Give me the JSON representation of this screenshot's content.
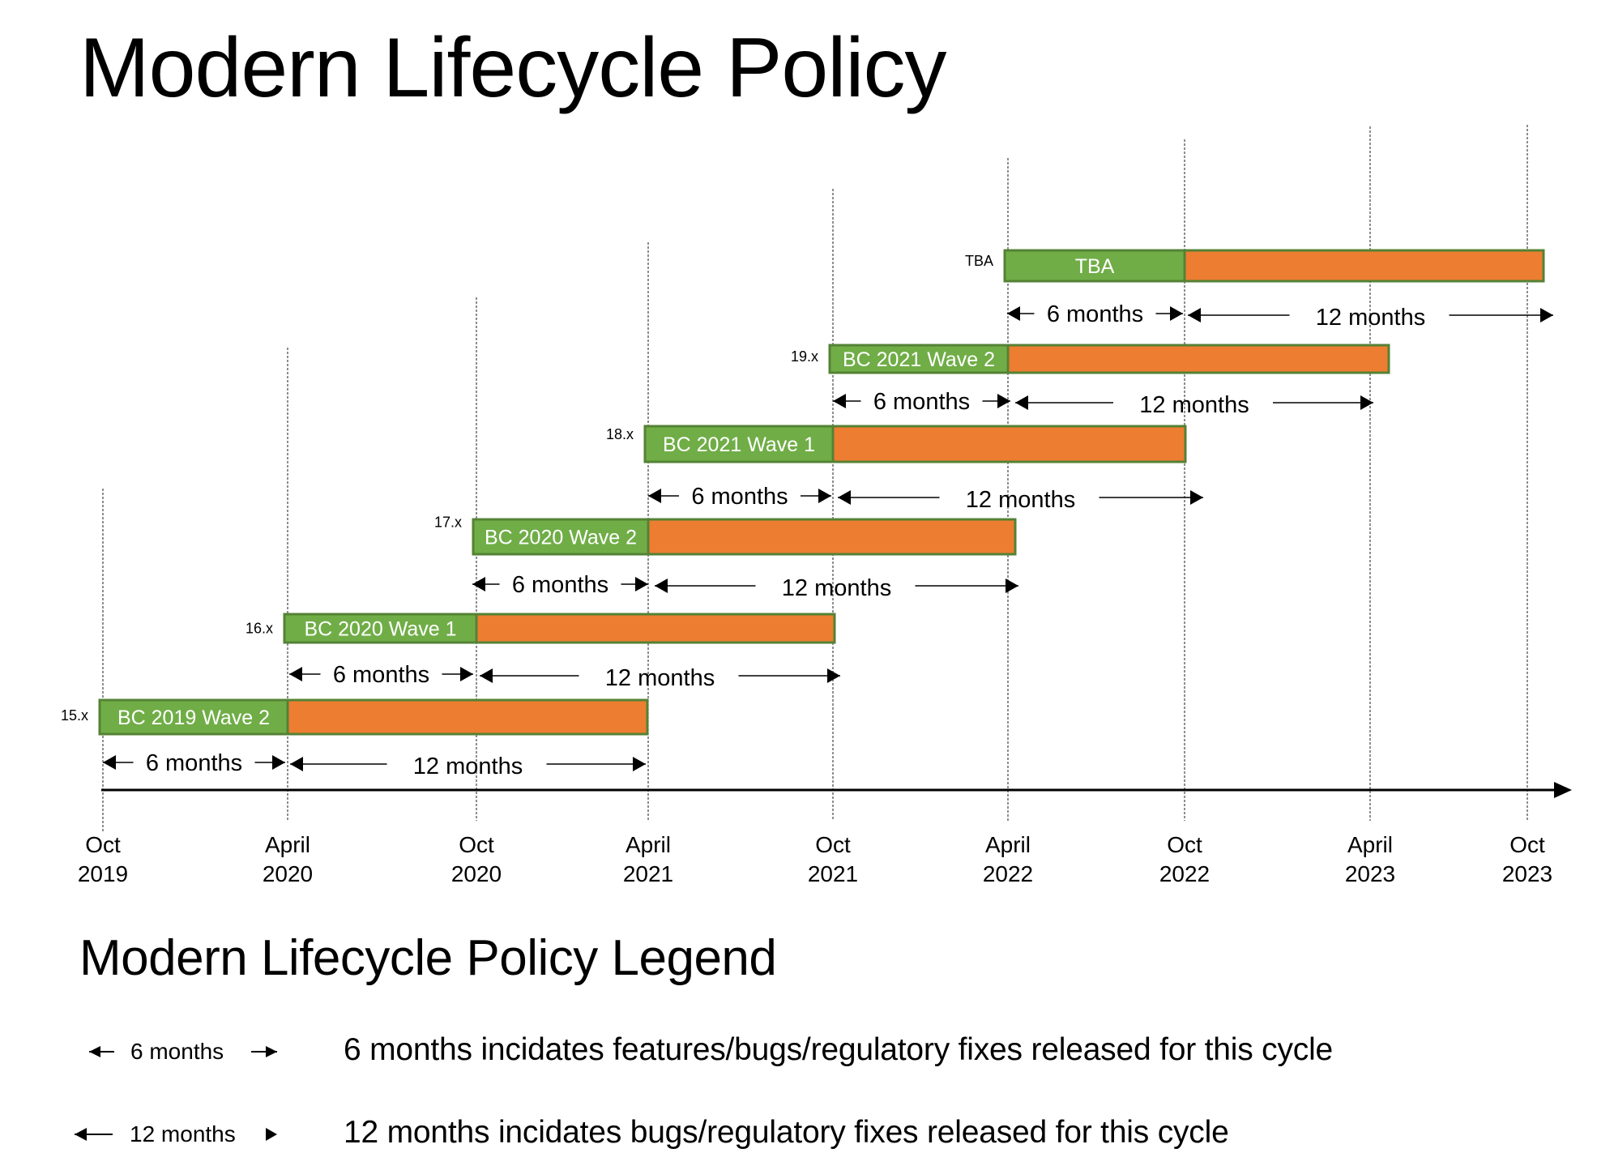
{
  "title": "Modern Lifecycle Policy",
  "colors": {
    "mainstream": "#70AD47",
    "extended": "#ED7D31",
    "bar_border": "#548235",
    "axis": "#000000",
    "gridline": "#444444"
  },
  "chart_data": {
    "type": "gantt",
    "title": "Modern Lifecycle Policy",
    "xlabel": "",
    "ylabel": "",
    "x_unit": "months since Oct 2019",
    "xlim": [
      0,
      48
    ],
    "ticks": [
      {
        "m": 0,
        "month": "Oct",
        "year": "2019"
      },
      {
        "m": 6,
        "month": "April",
        "year": "2020"
      },
      {
        "m": 12,
        "month": "Oct",
        "year": "2020"
      },
      {
        "m": 18,
        "month": "April",
        "year": "2021"
      },
      {
        "m": 24,
        "month": "Oct",
        "year": "2021"
      },
      {
        "m": 30,
        "month": "April",
        "year": "2022"
      },
      {
        "m": 36,
        "month": "Oct",
        "year": "2022"
      },
      {
        "m": 42,
        "month": "April",
        "year": "2023"
      },
      {
        "m": 48,
        "month": "Oct",
        "year": "2023"
      }
    ],
    "series": [
      {
        "name": "6 months",
        "meaning": "mainstream (features/bugs/regulatory fixes)"
      },
      {
        "name": "12 months",
        "meaning": "extended (bugs/regulatory fixes)"
      }
    ],
    "releases": [
      {
        "version": "15.x",
        "name": "BC 2019 Wave 2",
        "start": 0,
        "mainstream_months": 6,
        "extended_months": 12,
        "span_label_1": "6 months",
        "span_label_2": "12 months"
      },
      {
        "version": "16.x",
        "name": "BC 2020 Wave 1",
        "start": 6,
        "mainstream_months": 6,
        "extended_months": 12,
        "span_label_1": "6 months",
        "span_label_2": "12 months"
      },
      {
        "version": "17.x",
        "name": "BC 2020 Wave 2",
        "start": 12,
        "mainstream_months": 6,
        "extended_months": 12,
        "span_label_1": "6 months",
        "span_label_2": "12 months"
      },
      {
        "version": "18.x",
        "name": "BC 2021 Wave 1",
        "start": 18,
        "mainstream_months": 6,
        "extended_months": 12,
        "span_label_1": "6 months",
        "span_label_2": "12 months"
      },
      {
        "version": "19.x",
        "name": "BC 2021 Wave 2",
        "start": 24,
        "mainstream_months": 6,
        "extended_months": 12,
        "span_label_1": "6 months",
        "span_label_2": "12 months"
      },
      {
        "version": "TBA",
        "name": "TBA",
        "start": 30,
        "mainstream_months": 6,
        "extended_months": 12,
        "span_label_1": "6 months",
        "span_label_2": "12 months"
      }
    ]
  },
  "legend": {
    "title": "Modern Lifecycle Policy Legend",
    "items": [
      {
        "key": "6 months",
        "description": "6 months incidates features/bugs/regulatory fixes released for this cycle"
      },
      {
        "key": "12 months",
        "description": "12 months incidates bugs/regulatory fixes released for this cycle"
      }
    ]
  }
}
